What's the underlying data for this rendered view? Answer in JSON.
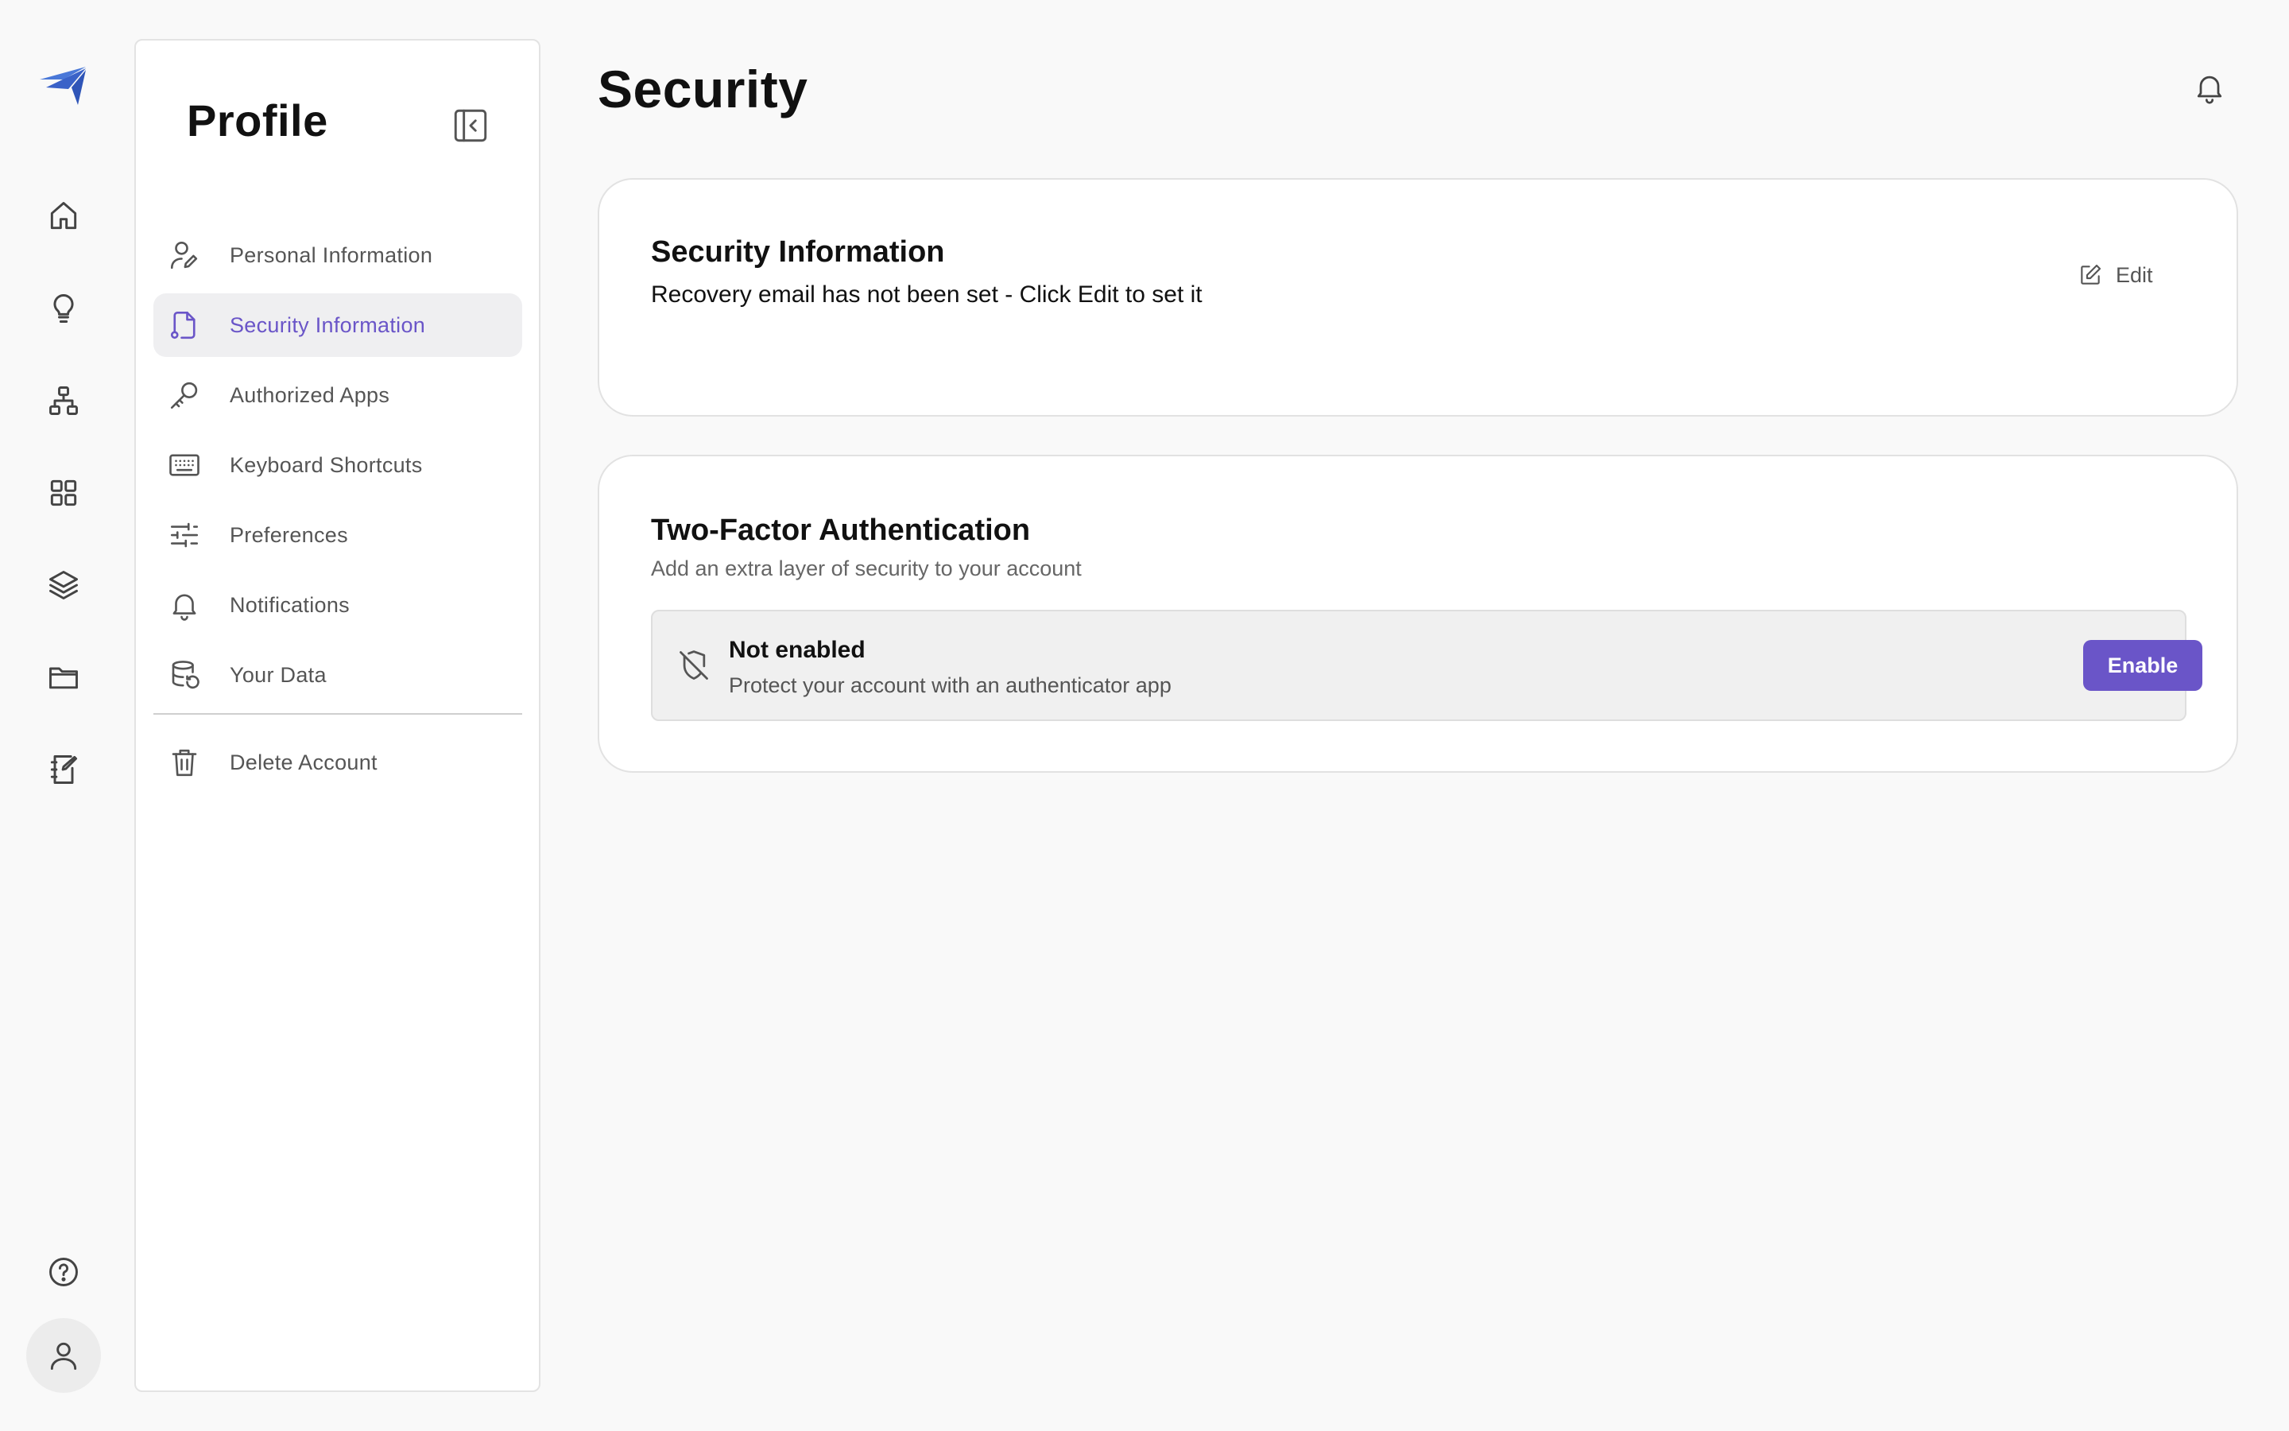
{
  "sidebar": {
    "title": "Profile",
    "items": [
      {
        "label": "Personal Information",
        "icon": "user-edit-icon"
      },
      {
        "label": "Security Information",
        "icon": "file-key-icon",
        "active": true
      },
      {
        "label": "Authorized Apps",
        "icon": "key-icon"
      },
      {
        "label": "Keyboard Shortcuts",
        "icon": "keyboard-icon"
      },
      {
        "label": "Preferences",
        "icon": "sliders-icon"
      },
      {
        "label": "Notifications",
        "icon": "bell-icon"
      },
      {
        "label": "Your Data",
        "icon": "database-icon"
      }
    ],
    "danger_item": {
      "label": "Delete Account",
      "icon": "trash-icon"
    }
  },
  "main": {
    "title": "Security",
    "security_card": {
      "title": "Security Information",
      "description": "Recovery email has not been set - Click Edit to set it",
      "edit_label": "Edit"
    },
    "two_factor_card": {
      "title": "Two-Factor Authentication",
      "description": "Add an extra layer of security to your account",
      "status_title": "Not enabled",
      "status_description": "Protect your account with an authenticator app",
      "enable_label": "Enable"
    }
  },
  "colors": {
    "accent": "#6a55c8",
    "background": "#f9f9f9",
    "active_nav_bg": "#efeff1"
  }
}
